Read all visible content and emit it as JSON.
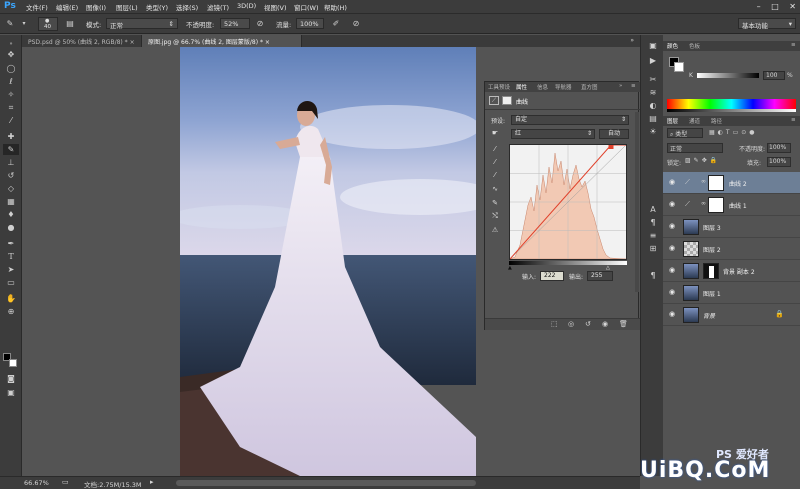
{
  "app": {
    "logo": "Ps"
  },
  "menu": [
    "文件(F)",
    "编辑(E)",
    "图像(I)",
    "图层(L)",
    "类型(Y)",
    "选择(S)",
    "滤镜(T)",
    "3D(D)",
    "视图(V)",
    "窗口(W)",
    "帮助(H)"
  ],
  "window_controls": [
    "–",
    "□",
    "✕"
  ],
  "options": {
    "brush_size": "40",
    "mode_label": "模式:",
    "mode_value": "正常",
    "opacity_label": "不透明度:",
    "opacity_value": "52%",
    "flow_label": "流量:",
    "flow_value": "100%",
    "workspace": "基本功能"
  },
  "tabs": [
    {
      "label": "PSD.psd @ 50% (曲线 2, RGB/8) *",
      "active": false
    },
    {
      "label": "原图.jpg @ 66.7% (曲线 2, 图层蒙版/8) *",
      "active": true
    }
  ],
  "status": {
    "zoom": "66.67%",
    "doc": "文档:2.75M/15.3M"
  },
  "properties": {
    "tabs": [
      "工具预设",
      "属性",
      "信息",
      "导航器",
      "直方图"
    ],
    "active_tab": "属性",
    "title": "曲线",
    "preset_label": "预设:",
    "preset_value": "自定",
    "channel_value": "红",
    "auto_label": "自动",
    "input_label": "输入:",
    "input_value": "222",
    "output_label": "输出:",
    "output_value": "255"
  },
  "color_panel": {
    "tabs": [
      "颜色",
      "色板"
    ],
    "channel_label": "K",
    "value": "100",
    "unit": "%"
  },
  "layers_panel": {
    "tabs": [
      "图层",
      "通道",
      "路径"
    ],
    "kind_label": "类型",
    "blend_mode": "正常",
    "opacity_label": "不透明度:",
    "opacity_value": "100%",
    "lock_label": "锁定:",
    "fill_label": "填充:",
    "fill_value": "100%",
    "layers": [
      {
        "name": "曲线 2",
        "selected": true
      },
      {
        "name": "曲线 1",
        "selected": false
      },
      {
        "name": "图层 3",
        "selected": false
      },
      {
        "name": "图层 2",
        "selected": false
      },
      {
        "name": "背景 副本 2",
        "selected": false
      },
      {
        "name": "图层 1",
        "selected": false
      },
      {
        "name": "背景",
        "selected": false
      }
    ]
  },
  "watermark": {
    "brand": "PS 爱好者",
    "site": "UiBQ.CoM"
  },
  "colors": {
    "chrome": "#3c3c3c",
    "workspace": "#535353",
    "selected_layer": "#6d7f96",
    "curve_line": "#e0402a",
    "histogram": "#f2c9b4"
  }
}
